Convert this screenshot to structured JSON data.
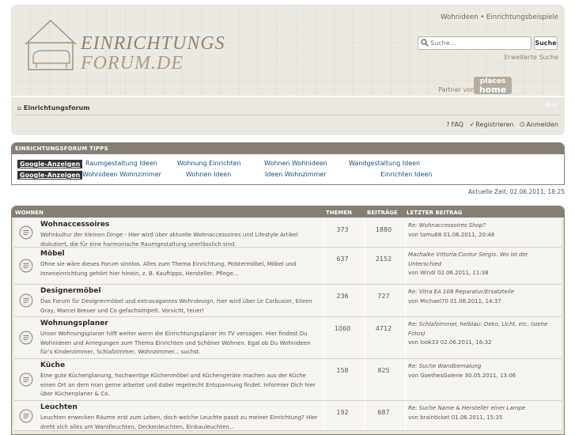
{
  "header": {
    "top_links": "Wohnideen • Einrichtungsbeispiele",
    "logo_line1": "EINRICHTUNGS",
    "logo_line2": "FORUM.DE",
    "search_placeholder": "Suche…",
    "search_button": "Suche",
    "advanced_search": "Erweiterte Suche",
    "partner_label": "Partner von",
    "partner_logo_line1": "places",
    "partner_logo_line2": "home"
  },
  "nav": {
    "breadcrumb": "Einrichtungsforum",
    "font_resize": "-A+",
    "faq": "FAQ",
    "register": "Registrieren",
    "login": "Anmelden"
  },
  "tipps": {
    "heading": "EINRICHTUNGSFORUM TIPPS",
    "ad_label": "Google-Anzeigen",
    "row1": [
      "Raumgestaltung Ideen",
      "Wohnung Einrichten",
      "Wohnen Wohnideen",
      "Wandgestaltung Ideen"
    ],
    "row2": [
      "Wohnideen Wohnzimmer",
      "Wohnen Ideen",
      "Ideen Wohnzimmer",
      "Einrichten Ideen"
    ]
  },
  "current_time": "Aktuelle Zeit: 02.06.2011, 18:25",
  "forum": {
    "category": "WOHNEN",
    "col_topics": "THEMEN",
    "col_posts": "BEITRÄGE",
    "col_last": "LETZTER BEITRAG",
    "rows": [
      {
        "title": "Wohnaccessoires",
        "desc": "Wohnkultur der kleinen Dinge - Hier wird über aktuelle Wohnaccessoires und Lifestyle Artikel diskutiert, die für eine harmonische Raumgestaltung unerlässlich sind.",
        "topics": "373",
        "posts": "1880",
        "last_title": "Re: Wohnaccessoires Shop?",
        "last_by": "von tamu68 01.06.2011, 20:48"
      },
      {
        "title": "Möbel",
        "desc": "Ohne sie wäre dieses Forum sinnlos. Alles zum Thema Einrichtung, Polstermöbel, Möbel und Inneneinrichtung gehört hier hinein, z. B. Kauftipps, Hersteller, Pflege...",
        "topics": "637",
        "posts": "2152",
        "last_title": "Machalke Vittoria:Contur Sergio. Wo ist der Unterschied",
        "last_by": "von Windi 02.06.2011, 11:38"
      },
      {
        "title": "Designermöbel",
        "desc": "Das Forum für Designermöbel und extravagantes Wohndesign, hier wird über Le Corbusier, Eileen Gray, Marcel Breuer und Co gefachsimpelt. Vorsicht, teuer!",
        "topics": "236",
        "posts": "727",
        "last_title": "Re: Vitra EA 108 Reparatur/Ersatzteile",
        "last_by": "von Michael70 01.06.2011, 14:37"
      },
      {
        "title": "Wohnungsplaner",
        "desc": "Unser Wohnungsplaner hilft weiter wenn die Einrichtungsplaner im TV versagen. Hier findest Du Wohnideen und Anregungen zum Thema Einrichten und Schöner Wohnen. Egal ob Du Wohnideen für's Kinderzimmer, Schlafzimmer, Wohnzimmer... suchst.",
        "topics": "1060",
        "posts": "4712",
        "last_title": "Re: Schlafzimmer, helblau: Deko, Licht, etc. (siehe Fotos)",
        "last_by": "von look33 02.06.2011, 16:32"
      },
      {
        "title": "Küche",
        "desc": "Eine gute Küchenplanung, hochwertige Küchenmöbel und Küchengeräte machen aus der Küche einen Ort an dem man gerne arbeitet und dabei regelrecht Entspannung findet. Informier Dich hier über Küchenplaner & Co.",
        "topics": "158",
        "posts": "825",
        "last_title": "Re: Suche Wandbemalung",
        "last_by": "von GoethesGalerie 30.05.2011, 13:06"
      },
      {
        "title": "Leuchten",
        "desc": "Leuchten erwecken Räume erst zum Leben, doch welche Leuchte passt zu meiner Einrichtung? Hier dreht sich alles um Wandleuchten, Deckenleuchten, Einbauleuchten...",
        "topics": "192",
        "posts": "687",
        "last_title": "Re: Suche Name & Hersteller einer Lampe",
        "last_by": "von brainticket 01.06.2011, 15:35"
      }
    ]
  },
  "colors": {
    "header_bg": "#ede9e1",
    "bar": "#857f73",
    "link": "#105289",
    "row_bg": "#f7f5f1"
  }
}
